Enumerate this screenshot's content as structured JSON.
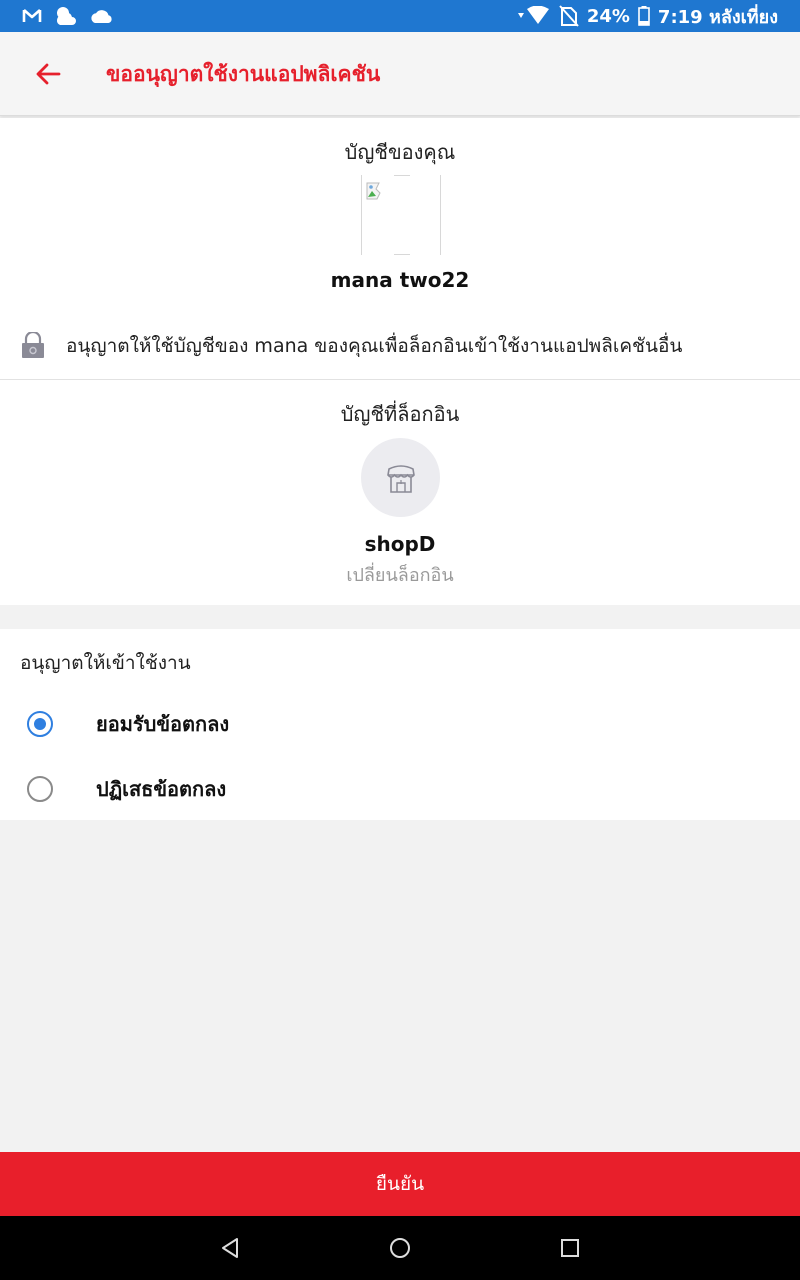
{
  "status_bar": {
    "battery_percent": "24%",
    "time": "7:19 หลังเที่ยง",
    "icons": [
      "gmail-icon",
      "weather-icon",
      "cloud-icon",
      "wifi-icon",
      "no-sim-icon",
      "battery-icon"
    ]
  },
  "header": {
    "back_icon": "arrow-left-icon",
    "title": "ขออนุญาตใช้งานแอปพลิเคชัน"
  },
  "account": {
    "heading": "บัญชีของคุณ",
    "name": "mana two22",
    "permission_text": "อนุญาตให้ใช้บัญชีของ mana ของคุณเพื่อล็อกอินเข้าใช้งานแอปพลิเคชันอื่น"
  },
  "login_account": {
    "heading": "บัญชีที่ล็อกอิน",
    "shop_name": "shopD",
    "switch_label": "เปลี่ยนล็อกอิน"
  },
  "consent": {
    "heading": "อนุญาตให้เข้าใช้งาน",
    "options": [
      {
        "label": "ยอมรับข้อตกลง",
        "selected": true
      },
      {
        "label": "ปฏิเสธข้อตกลง",
        "selected": false
      }
    ]
  },
  "confirm_label": "ยืนยัน",
  "colors": {
    "status_bar": "#1f77d0",
    "accent_red": "#e6202c",
    "confirm_button": "#e81f2b",
    "radio_selected": "#2f7fe0"
  }
}
